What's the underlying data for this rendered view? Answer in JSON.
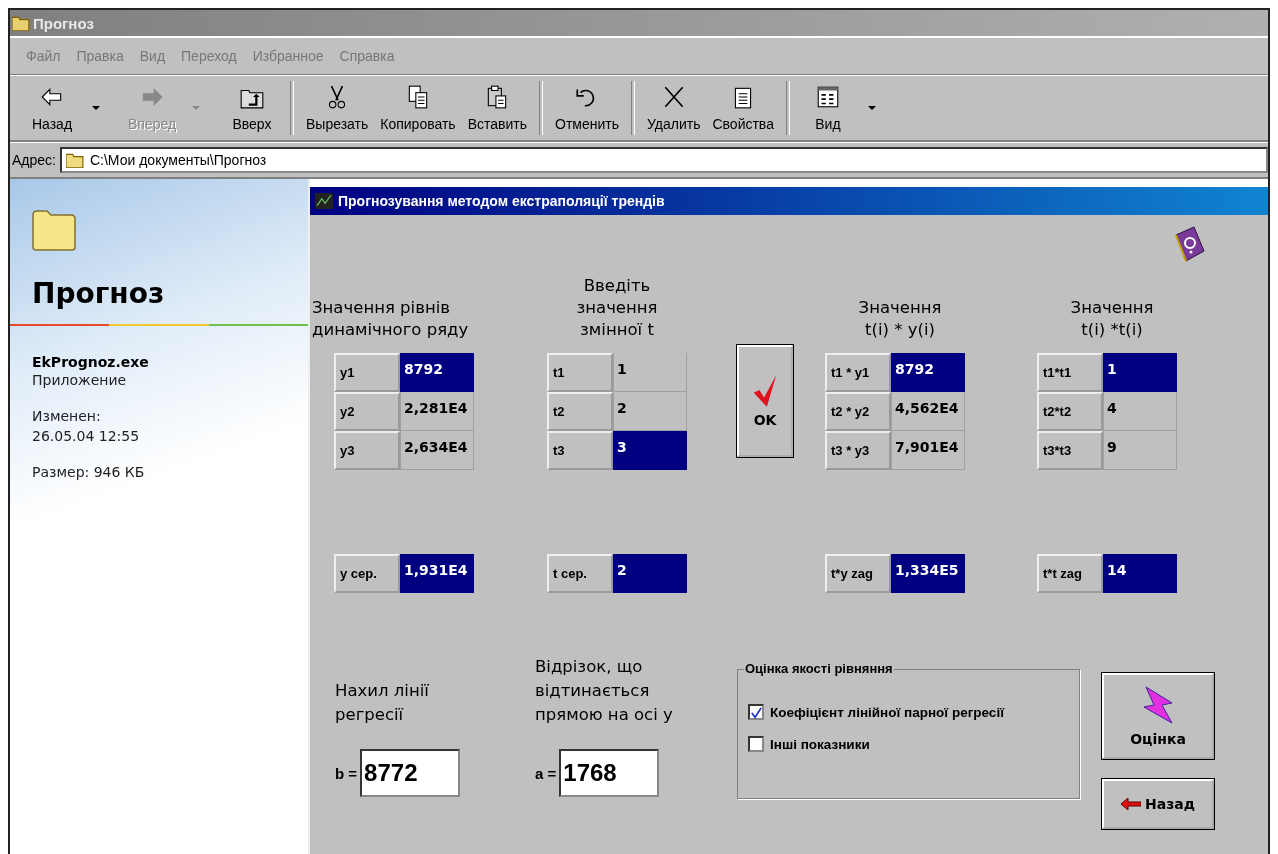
{
  "window": {
    "title": "Прогноз"
  },
  "menu": [
    "Файл",
    "Правка",
    "Вид",
    "Переход",
    "Избранное",
    "Справка"
  ],
  "toolbar": [
    [
      {
        "label": "Назад",
        "kind": "back",
        "disabled": false,
        "dropdown": true
      },
      {
        "label": "Вперед",
        "kind": "forward",
        "disabled": true,
        "dropdown": true
      },
      {
        "label": "Вверх",
        "kind": "up",
        "disabled": false,
        "dropdown": false
      }
    ],
    [
      {
        "label": "Вырезать",
        "kind": "cut",
        "disabled": false,
        "dropdown": false
      },
      {
        "label": "Копировать",
        "kind": "copy",
        "disabled": false,
        "dropdown": false
      },
      {
        "label": "Вставить",
        "kind": "paste",
        "disabled": false,
        "dropdown": false
      }
    ],
    [
      {
        "label": "Отменить",
        "kind": "undo",
        "disabled": false,
        "dropdown": false
      }
    ],
    [
      {
        "label": "Удалить",
        "kind": "delete",
        "disabled": false,
        "dropdown": false
      },
      {
        "label": "Свойства",
        "kind": "properties",
        "disabled": false,
        "dropdown": false
      }
    ],
    [
      {
        "label": "Вид",
        "kind": "views",
        "disabled": false,
        "dropdown": true
      }
    ]
  ],
  "address": {
    "label": "Адрес:",
    "value": "C:\\Мои документы\\Прогноз"
  },
  "sidebar": {
    "title": "Прогноз",
    "file": "EkPrognoz.exe",
    "type": "Приложение",
    "modified_label": "Изменен:",
    "modified": "26.05.04 12:55",
    "size": "Размер: 946 КБ"
  },
  "dialog": {
    "title": "Прогнозування методом екстраполяції трендів",
    "groups": [
      {
        "heading": "Значення рівнів\nдинамічного ряду",
        "rows": [
          {
            "label": "y1",
            "value": "8792",
            "selected": true
          },
          {
            "label": "y2",
            "value": "2,281E4",
            "selected": false
          },
          {
            "label": "y3",
            "value": "2,634E4",
            "selected": false
          }
        ],
        "total": {
          "label": "y сер.",
          "value": "1,931E4",
          "selected": true
        }
      },
      {
        "heading": "Введіть\nзначення\nзмінної t",
        "rows": [
          {
            "label": "t1",
            "value": "1",
            "selected": false
          },
          {
            "label": "t2",
            "value": "2",
            "selected": false
          },
          {
            "label": "t3",
            "value": "3",
            "selected": true
          }
        ],
        "total": {
          "label": "t сер.",
          "value": "2",
          "selected": true
        }
      },
      {
        "heading": "Значення\nt(i) * y(i)",
        "rows": [
          {
            "label": "t1 * y1",
            "value": "8792",
            "selected": true
          },
          {
            "label": "t2 * y2",
            "value": "4,562E4",
            "selected": false
          },
          {
            "label": "t3 * y3",
            "value": "7,901E4",
            "selected": false
          }
        ],
        "total": {
          "label": "t*y zag",
          "value": "1,334E5",
          "selected": true
        }
      },
      {
        "heading": "Значення\nt(i) *t(i)",
        "rows": [
          {
            "label": "t1*t1",
            "value": "1",
            "selected": true
          },
          {
            "label": "t2*t2",
            "value": "4",
            "selected": false
          },
          {
            "label": "t3*t3",
            "value": "9",
            "selected": false
          }
        ],
        "total": {
          "label": "t*t zag",
          "value": "14",
          "selected": true
        }
      }
    ],
    "ok_button": "OK",
    "slope": {
      "caption": "Нахил лінії\nрегресії",
      "label": "b =",
      "value": "8772"
    },
    "intercept": {
      "caption": "Відрізок, що\nвідтинається\nпрямою на осі у",
      "label": "a =",
      "value": "1768"
    },
    "quality": {
      "title": "Оцінка якості рівняння",
      "options": [
        {
          "label": "Коефіцієнт лінійної парної регресії",
          "checked": true
        },
        {
          "label": "Інші показники",
          "checked": false
        }
      ]
    },
    "buttons": [
      {
        "label": "Оцінка",
        "kind": "assess"
      },
      {
        "label": "Назад",
        "kind": "back"
      }
    ]
  }
}
